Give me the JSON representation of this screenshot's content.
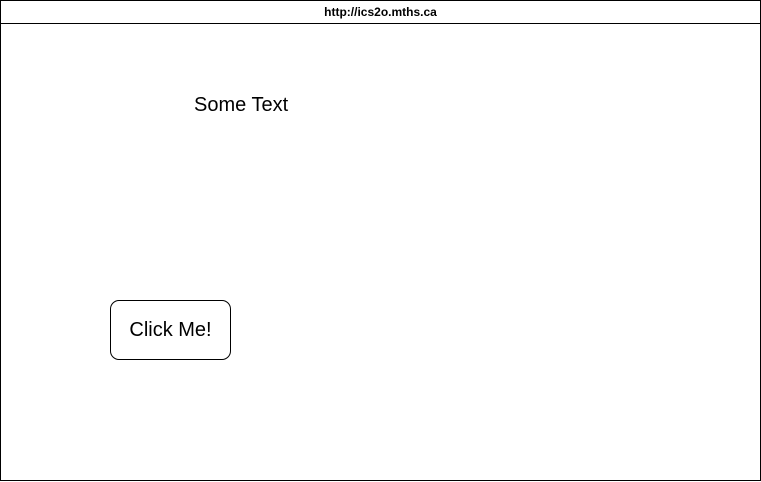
{
  "browser": {
    "address": "http://ics2o.mths.ca"
  },
  "page": {
    "text": "Some Text",
    "button_label": "Click Me!"
  }
}
